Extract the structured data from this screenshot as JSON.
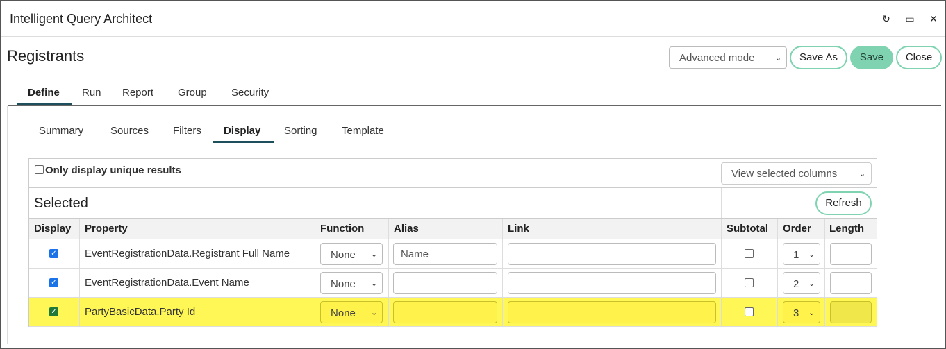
{
  "window": {
    "title": "Intelligent Query Architect",
    "controls": [
      "refresh-icon",
      "maximize-icon",
      "close-icon"
    ],
    "controls_glyphs": {
      "refresh": "↻",
      "maximize": "▭",
      "close": "✕"
    }
  },
  "page": {
    "title": "Registrants",
    "mode_select": "Advanced mode",
    "buttons": {
      "save_as": "Save As",
      "save": "Save",
      "close": "Close"
    }
  },
  "main_tabs": [
    "Define",
    "Run",
    "Report",
    "Group",
    "Security"
  ],
  "sub_tabs": [
    "Summary",
    "Sources",
    "Filters",
    "Display",
    "Sorting",
    "Template"
  ],
  "display": {
    "unique_label": "Only display unique results",
    "unique_checked": false,
    "view_select": "View selected columns",
    "section_title": "Selected",
    "refresh_label": "Refresh",
    "columns": [
      "Display",
      "Property",
      "Function",
      "Alias",
      "Link",
      "Subtotal",
      "Order",
      "Length"
    ],
    "rows": [
      {
        "display": true,
        "property": "EventRegistrationData.Registrant Full Name",
        "function": "None",
        "alias": "",
        "alias_placeholder": "Name",
        "link": "",
        "subtotal": false,
        "order": "1",
        "length": "",
        "highlighted": false
      },
      {
        "display": true,
        "property": "EventRegistrationData.Event Name",
        "function": "None",
        "alias": "",
        "alias_placeholder": "",
        "link": "",
        "subtotal": false,
        "order": "2",
        "length": "",
        "highlighted": false
      },
      {
        "display": true,
        "property": "PartyBasicData.Party Id",
        "function": "None",
        "alias": "",
        "alias_placeholder": "",
        "link": "",
        "subtotal": false,
        "order": "3",
        "length": "",
        "highlighted": true
      }
    ]
  },
  "colors": {
    "accent": "#7fd3b0",
    "tab_underline": "#1d4f5c",
    "highlight": "#fff756"
  }
}
